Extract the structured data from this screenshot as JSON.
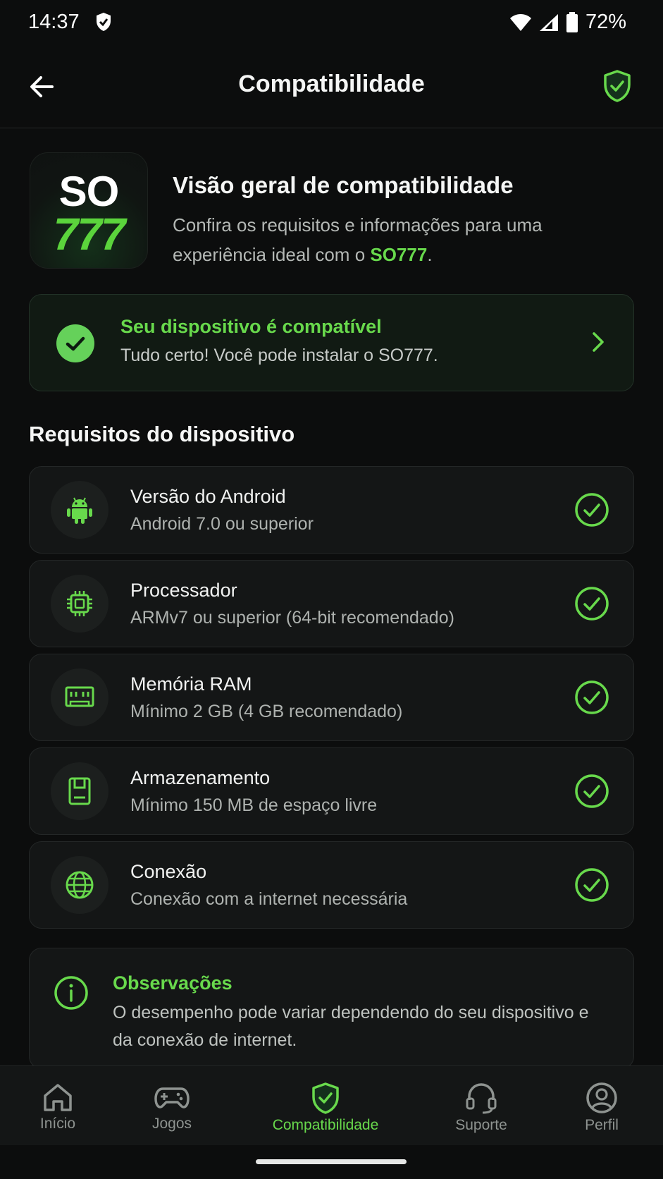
{
  "status_bar": {
    "time": "14:37",
    "battery": "72%"
  },
  "app_bar": {
    "title": "Compatibilidade"
  },
  "hero": {
    "logo_top": "SO",
    "logo_bottom": "777",
    "title": "Visão geral de compatibilidade",
    "desc_prefix": "Confira os requisitos e informações para uma experiência ideal com o ",
    "desc_brand": "SO777",
    "desc_suffix": "."
  },
  "compat_card": {
    "title": "Seu dispositivo é compatível",
    "subtitle": "Tudo certo! Você pode instalar o SO777."
  },
  "requirements": {
    "heading": "Requisitos do dispositivo",
    "items": [
      {
        "title": "Versão do Android",
        "subtitle": "Android 7.0 ou superior",
        "icon": "android-icon"
      },
      {
        "title": "Processador",
        "subtitle": "ARMv7 ou superior (64-bit recomendado)",
        "icon": "cpu-icon"
      },
      {
        "title": "Memória RAM",
        "subtitle": "Mínimo 2 GB (4 GB recomendado)",
        "icon": "ram-icon"
      },
      {
        "title": "Armazenamento",
        "subtitle": "Mínimo 150 MB de espaço livre",
        "icon": "storage-icon"
      },
      {
        "title": "Conexão",
        "subtitle": "Conexão com a internet necessária",
        "icon": "globe-icon"
      }
    ]
  },
  "notes": {
    "title": "Observações",
    "text": "O desempenho pode variar dependendo do seu dispositivo e da conexão de internet."
  },
  "nav": {
    "items": [
      {
        "label": "Início",
        "icon": "home-icon"
      },
      {
        "label": "Jogos",
        "icon": "gamepad-icon"
      },
      {
        "label": "Compatibilidade",
        "icon": "shield-check-icon",
        "active": true
      },
      {
        "label": "Suporte",
        "icon": "headset-icon"
      },
      {
        "label": "Perfil",
        "icon": "user-icon"
      }
    ]
  },
  "colors": {
    "accent": "#68d94c",
    "background": "#0c0d0d",
    "card": "#141616"
  }
}
